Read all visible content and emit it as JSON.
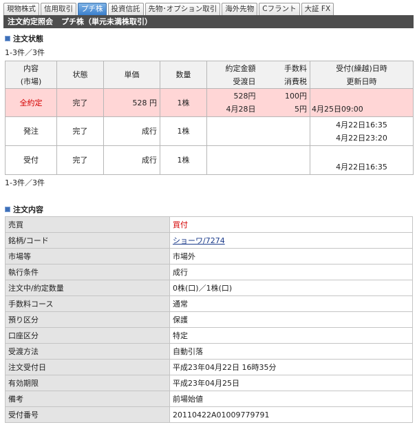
{
  "tabs": [
    "現物株式",
    "信用取引",
    "プチ株",
    "投資信託",
    "先物･オプション取引",
    "海外先物",
    "Cフラント",
    "大証 FX"
  ],
  "active_tab": 2,
  "section_bar": {
    "title": "注文約定照会",
    "subtitle": "プチ株（単元未満株取引）"
  },
  "status_section": {
    "heading": "注文状態",
    "count_top": "1-3件／3件",
    "count_bottom": "1-3件／3件",
    "headers": {
      "content": "内容",
      "market": "(市場)",
      "state": "状態",
      "price": "単価",
      "qty": "数量",
      "amount": "約定金額",
      "delivery": "受渡日",
      "fee": "手数料",
      "tax": "消費税",
      "accept_dt": "受付(繰越)日時",
      "update_dt": "更新日時"
    },
    "rows": [
      {
        "content": "全約定",
        "state": "完了",
        "price": "528 円",
        "qty": "1株",
        "amount": "528円",
        "delivery": "4月28日",
        "fee": "100円",
        "tax": "5円",
        "dt1": "",
        "dt2": "4月25日09:00"
      },
      {
        "content": "発注",
        "state": "完了",
        "price": "成行",
        "qty": "1株",
        "amount": "",
        "delivery": "",
        "fee": "",
        "tax": "",
        "dt1": "4月22日16:35",
        "dt2": "4月22日23:20"
      },
      {
        "content": "受付",
        "state": "完了",
        "price": "成行",
        "qty": "1株",
        "amount": "",
        "delivery": "",
        "fee": "",
        "tax": "",
        "dt1": "",
        "dt2": "4月22日16:35"
      }
    ]
  },
  "order_section": {
    "heading": "注文内容",
    "fields": [
      {
        "label": "売買",
        "value": "買付"
      },
      {
        "label": "銘柄/コード",
        "value": "ショーワ/7274"
      },
      {
        "label": "市場等",
        "value": "市場外"
      },
      {
        "label": "執行条件",
        "value": "成行"
      },
      {
        "label": "注文中/約定数量",
        "value": "0株(口)／1株(口)"
      },
      {
        "label": "手数料コース",
        "value": "通常"
      },
      {
        "label": "預り区分",
        "value": "保護"
      },
      {
        "label": "口座区分",
        "value": "特定"
      },
      {
        "label": "受渡方法",
        "value": "自動引落"
      },
      {
        "label": "注文受付日",
        "value": "平成23年04月22日 16時35分"
      },
      {
        "label": "有効期限",
        "value": "平成23年04月25日"
      },
      {
        "label": "備考",
        "value": "前場始値"
      },
      {
        "label": "受付番号",
        "value": "20110422A01009779791"
      }
    ]
  },
  "colors": {
    "buy": "#d40000",
    "highlight_row": "#ffd6d6",
    "section_bar": "#4d4d4d",
    "active_tab": "#3b7fcc"
  }
}
